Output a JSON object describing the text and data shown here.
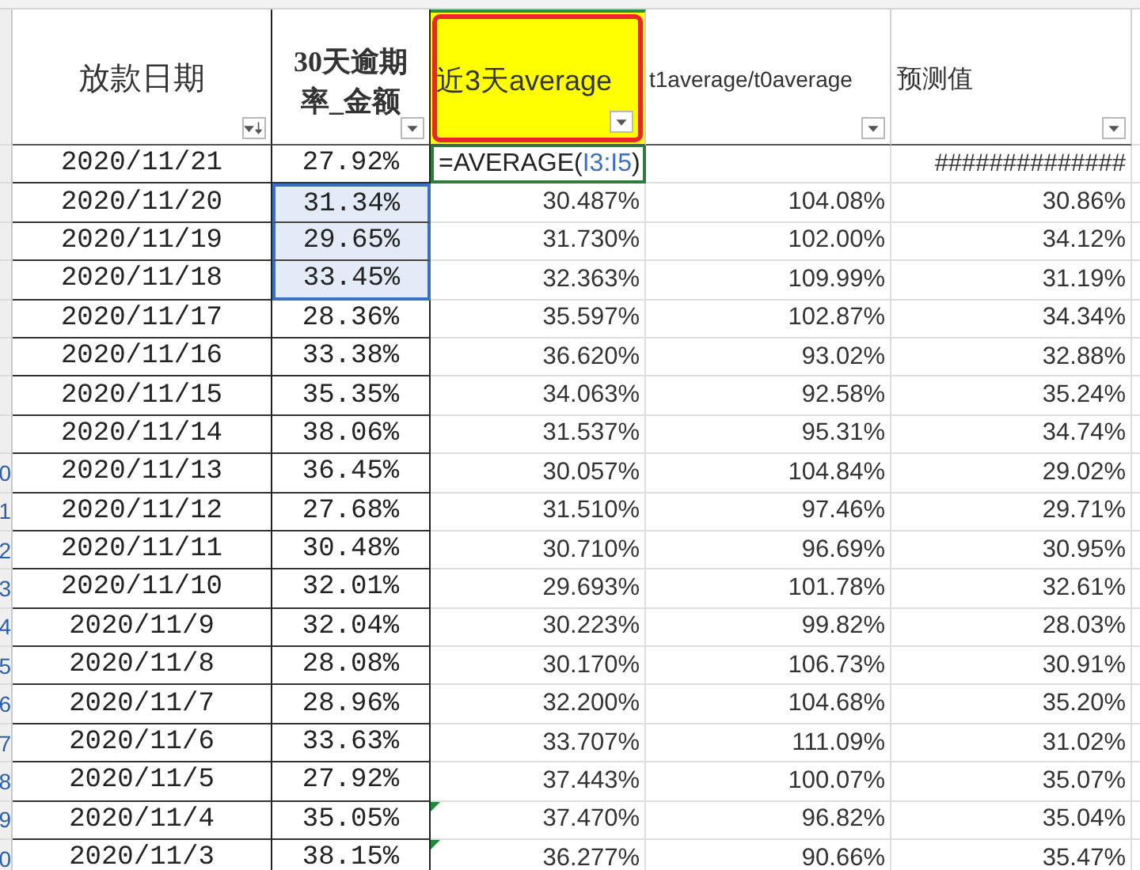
{
  "columns": [
    {
      "title": "放款日期",
      "kind": "sort",
      "highlighted": false
    },
    {
      "title": "30天逾期率_金额",
      "kind": "dropdown",
      "highlighted": false
    },
    {
      "title": "近3天average",
      "kind": "dropdown",
      "highlighted": true
    },
    {
      "title": "t1average/t0average",
      "kind": "dropdown",
      "highlighted": false
    },
    {
      "title": "预测值",
      "kind": "dropdown",
      "highlighted": false
    }
  ],
  "rows": [
    {
      "date": "2020/11/21",
      "rate": "27.92%",
      "formula": {
        "head": "=AVERAGE(",
        "ref": "I3:I5",
        "tail": ")"
      },
      "forecast": "##############",
      "selected": false,
      "warning": false
    },
    {
      "date": "2020/11/20",
      "rate": "31.34%",
      "avg3": "30.487%",
      "ratio": "104.08%",
      "forecast": "30.86%",
      "selected": true,
      "warning": false
    },
    {
      "date": "2020/11/19",
      "rate": "29.65%",
      "avg3": "31.730%",
      "ratio": "102.00%",
      "forecast": "34.12%",
      "selected": true,
      "warning": false
    },
    {
      "date": "2020/11/18",
      "rate": "33.45%",
      "avg3": "32.363%",
      "ratio": "109.99%",
      "forecast": "31.19%",
      "selected": true,
      "warning": false
    },
    {
      "date": "2020/11/17",
      "rate": "28.36%",
      "avg3": "35.597%",
      "ratio": "102.87%",
      "forecast": "34.34%",
      "selected": false,
      "warning": false
    },
    {
      "date": "2020/11/16",
      "rate": "33.38%",
      "avg3": "36.620%",
      "ratio": "93.02%",
      "forecast": "32.88%",
      "selected": false,
      "warning": false
    },
    {
      "date": "2020/11/15",
      "rate": "35.35%",
      "avg3": "34.063%",
      "ratio": "92.58%",
      "forecast": "35.24%",
      "selected": false,
      "warning": false
    },
    {
      "date": "2020/11/14",
      "rate": "38.06%",
      "avg3": "31.537%",
      "ratio": "95.31%",
      "forecast": "34.74%",
      "selected": false,
      "warning": false
    },
    {
      "row_number": "0",
      "date": "2020/11/13",
      "rate": "36.45%",
      "avg3": "30.057%",
      "ratio": "104.84%",
      "forecast": "29.02%",
      "selected": false,
      "warning": false
    },
    {
      "row_number": "1",
      "date": "2020/11/12",
      "rate": "27.68%",
      "avg3": "31.510%",
      "ratio": "97.46%",
      "forecast": "29.71%",
      "selected": false,
      "warning": false
    },
    {
      "row_number": "2",
      "date": "2020/11/11",
      "rate": "30.48%",
      "avg3": "30.710%",
      "ratio": "96.69%",
      "forecast": "30.95%",
      "selected": false,
      "warning": false
    },
    {
      "row_number": "3",
      "date": "2020/11/10",
      "rate": "32.01%",
      "avg3": "29.693%",
      "ratio": "101.78%",
      "forecast": "32.61%",
      "selected": false,
      "warning": false
    },
    {
      "row_number": "4",
      "date": "2020/11/9",
      "rate": "32.04%",
      "avg3": "30.223%",
      "ratio": "99.82%",
      "forecast": "28.03%",
      "selected": false,
      "warning": false
    },
    {
      "row_number": "5",
      "date": "2020/11/8",
      "rate": "28.08%",
      "avg3": "30.170%",
      "ratio": "106.73%",
      "forecast": "30.91%",
      "selected": false,
      "warning": false
    },
    {
      "row_number": "6",
      "date": "2020/11/7",
      "rate": "28.96%",
      "avg3": "32.200%",
      "ratio": "104.68%",
      "forecast": "35.20%",
      "selected": false,
      "warning": false
    },
    {
      "row_number": "7",
      "date": "2020/11/6",
      "rate": "33.63%",
      "avg3": "33.707%",
      "ratio": "111.09%",
      "forecast": "31.02%",
      "selected": false,
      "warning": false
    },
    {
      "row_number": "8",
      "date": "2020/11/5",
      "rate": "27.92%",
      "avg3": "37.443%",
      "ratio": "100.07%",
      "forecast": "35.07%",
      "selected": false,
      "warning": false
    },
    {
      "row_number": "9",
      "date": "2020/11/4",
      "rate": "35.05%",
      "avg3": "37.470%",
      "ratio": "96.82%",
      "forecast": "35.04%",
      "selected": false,
      "warning": true
    },
    {
      "row_number": "0",
      "date": "2020/11/3",
      "rate": "38.15%",
      "avg3": "36.277%",
      "ratio": "90.66%",
      "forecast": "35.47%",
      "selected": false,
      "warning": true
    }
  ]
}
